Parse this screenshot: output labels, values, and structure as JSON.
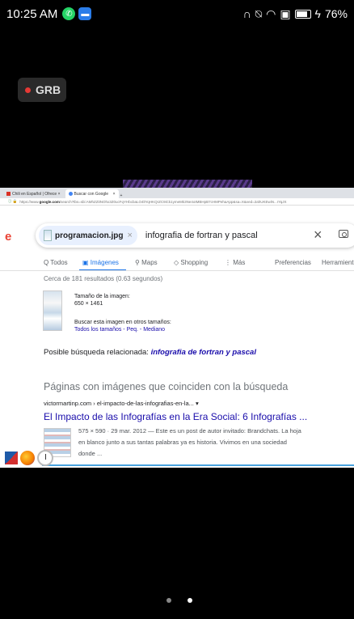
{
  "statusbar": {
    "time": "10:25 AM",
    "battery": "76%"
  },
  "rec": {
    "label": "GRB"
  },
  "browser": {
    "tabs": [
      "Chili en Español | Ofrece",
      "Buscar con Google"
    ],
    "new_tab": "+",
    "url_prefix": "https://www.",
    "url_domain": "google.com",
    "url_rest": "/search?tbs=sbi:AMhZZitNOhx3Z0ucFqYHbcbaLO4ltYqHKQrZC9iCk1ymeMk3Ne4otMBHpB7cHMPehaApp&sa=X&ved=2ahUKEwiN...rYqJX"
  },
  "google": {
    "logo": "e",
    "chip_label": "programacion.jpg",
    "chip_close": "×",
    "query": "infografia de fortran y pascal",
    "clear": "×",
    "nav": {
      "todos": "Q  Todos",
      "imagenes": "Imágenes",
      "maps": "Maps",
      "shopping": "Shopping",
      "mas": "⋮ Más",
      "preferencias": "Preferencias",
      "herramientas": "Herramient"
    },
    "stats": "Cerca de 181 resultados (0.63 segundos)",
    "size_label": "Tamaño de la imagen:",
    "size_value": "650 × 1461",
    "other_sizes": "Buscar esta imagen en otros tamaños:",
    "sizes_links": "Todos los tamaños - Peq. - Mediano",
    "related_prefix": "Posible búsqueda relacionada: ",
    "related_link": "infografia de fortran y pascal",
    "pages_title": "Páginas con imágenes que coinciden con la búsqueda",
    "result_url": "victormartinp.com › el-impacto-de-las-infografias-en-la...  ▾",
    "result_title": "El Impacto de las Infografías en la Era Social: 6 Infografías ...",
    "snippet1": "575 × 590 · 29 mar. 2012 — Este es un post de autor invitado: Brandchats. La hoja",
    "snippet2": "en blanco junto a sus tantas palabras ya es historia. Vivimos en una sociedad",
    "snippet3": "donde ..."
  }
}
